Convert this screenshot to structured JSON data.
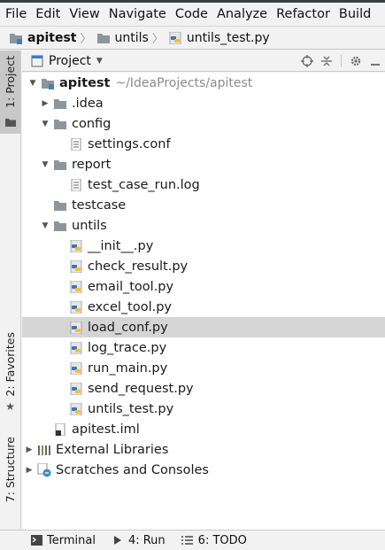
{
  "menu": [
    "File",
    "Edit",
    "View",
    "Navigate",
    "Code",
    "Analyze",
    "Refactor",
    "Build"
  ],
  "breadcrumb": [
    {
      "label": "apitest",
      "bold": true,
      "icon": "module-folder-icon"
    },
    {
      "label": "untils",
      "bold": false,
      "icon": "folder-icon"
    },
    {
      "label": "untils_test.py",
      "bold": false,
      "icon": "python-file-icon"
    }
  ],
  "left_stripe": {
    "project": "1: Project",
    "favorites": "2: Favorites",
    "structure": "7: Structure"
  },
  "panel": {
    "title": "Project",
    "tools": [
      "locate-icon",
      "collapse-all-icon",
      "gear-icon",
      "hide-icon"
    ]
  },
  "tree": {
    "root": {
      "label": "apitest",
      "path": "~/IdeaProjects/apitest"
    },
    "items": [
      {
        "label": ".idea",
        "type": "folder",
        "expanded": false
      },
      {
        "label": "config",
        "type": "folder",
        "expanded": true
      },
      {
        "label": "settings.conf",
        "type": "text-file"
      },
      {
        "label": "report",
        "type": "folder",
        "expanded": true
      },
      {
        "label": "test_case_run.log",
        "type": "text-file"
      },
      {
        "label": "testcase",
        "type": "folder"
      },
      {
        "label": "untils",
        "type": "folder",
        "expanded": true
      },
      {
        "label": "__init__.py",
        "type": "python-file"
      },
      {
        "label": "check_result.py",
        "type": "python-file"
      },
      {
        "label": "email_tool.py",
        "type": "python-file"
      },
      {
        "label": "excel_tool.py",
        "type": "python-file"
      },
      {
        "label": "load_conf.py",
        "type": "python-file",
        "selected": true
      },
      {
        "label": "log_trace.py",
        "type": "python-file"
      },
      {
        "label": "run_main.py",
        "type": "python-file"
      },
      {
        "label": "send_request.py",
        "type": "python-file"
      },
      {
        "label": "untils_test.py",
        "type": "python-file"
      },
      {
        "label": "apitest.iml",
        "type": "iml-file"
      },
      {
        "label": "External Libraries",
        "type": "libraries"
      },
      {
        "label": "Scratches and Consoles",
        "type": "scratches"
      }
    ]
  },
  "bottom": [
    {
      "label": "Terminal",
      "icon": "terminal-icon"
    },
    {
      "label": "4: Run",
      "icon": "run-icon"
    },
    {
      "label": "6: TODO",
      "icon": "todo-icon"
    }
  ]
}
